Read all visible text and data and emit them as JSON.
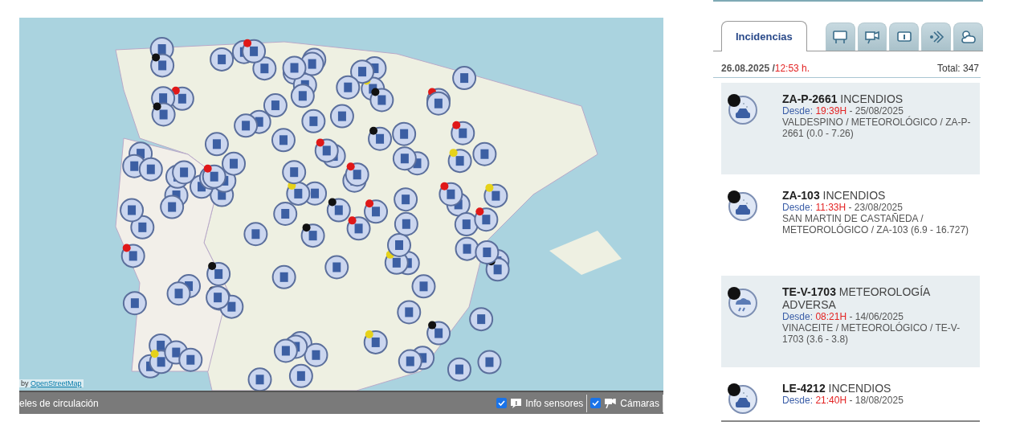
{
  "map": {
    "attribution_prefix": "by",
    "attribution_link": "OpenStreetMap"
  },
  "map_bar": {
    "left_text": "eles de circulación",
    "toggles": [
      {
        "kind": "info",
        "label": "Info sensores",
        "checked": true
      },
      {
        "kind": "camera",
        "label": "Cámaras",
        "checked": true
      }
    ]
  },
  "tabs": [
    {
      "kind": "text",
      "label": "Incidencias",
      "selected": true
    },
    {
      "kind": "panel",
      "selected": false
    },
    {
      "kind": "camera",
      "selected": false
    },
    {
      "kind": "info",
      "selected": false
    },
    {
      "kind": "signal",
      "selected": false
    },
    {
      "kind": "weather",
      "selected": false
    }
  ],
  "summary": {
    "date": "26.08.2025 /",
    "time": "12:53 h.",
    "total": "Total: 347"
  },
  "incidents": [
    {
      "kind": "car",
      "title": "**ZA-P-2661** INCENDIOS",
      "since_label": "Desde:",
      "time": "19:39H",
      "date": " - 25/08/2025",
      "location": "VALDESPINO / METEOROLÓGICO / ZA-P-2661 (0.0 - 7.26)"
    },
    {
      "kind": "car",
      "title": "**ZA-103** INCENDIOS",
      "since_label": "Desde:",
      "time": "11:33H",
      "date": " - 23/08/2025",
      "location": "SAN MARTIN DE CASTAÑEDA / METEOROLÓGICO / ZA-103 (6.9 - 16.727)"
    },
    {
      "kind": "cloud",
      "title": "**TE-V-1703** METEOROLOGÍA ADVERSA",
      "since_label": "Desde:",
      "time": "08:21H",
      "date": " - 14/06/2025",
      "location": "VINACEITE / METEOROLÓGICO / TE-V-1703 (3.6 - 3.8)"
    },
    {
      "kind": "car",
      "title": "**LE-4212** INCENDIOS",
      "since_label": "Desde:",
      "time": "21:40H",
      "date": " - 18/08/2025"
    }
  ]
}
